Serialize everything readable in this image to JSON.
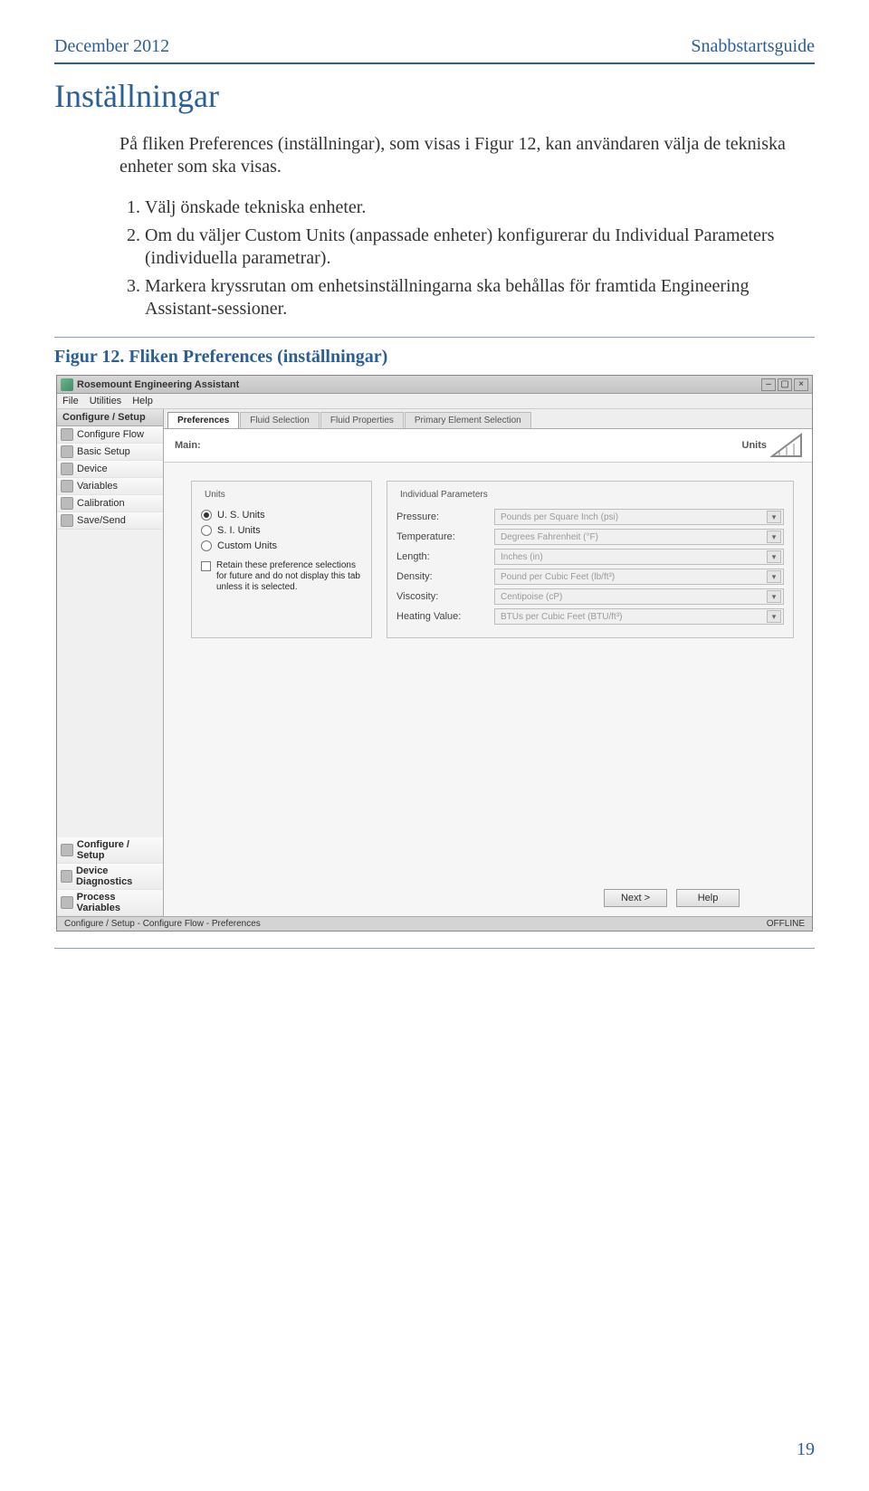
{
  "doc": {
    "date": "December 2012",
    "guide_label": "Snabbstartsguide",
    "section_title": "Inställningar",
    "intro": "På fliken Preferences (inställningar), som visas i Figur 12, kan användaren välja de tekniska enheter som ska visas.",
    "steps": [
      "Välj önskade tekniska enheter.",
      "Om du väljer Custom Units (anpassade enheter) konfigurerar du Individual Parameters (individuella parametrar).",
      "Markera kryssrutan om enhetsinställningarna ska behållas för framtida Engineering Assistant-sessioner."
    ],
    "figure_caption": "Figur 12. Fliken Preferences (inställningar)",
    "page_number": "19"
  },
  "app": {
    "title": "Rosemount Engineering Assistant",
    "menus": [
      "File",
      "Utilities",
      "Help"
    ],
    "nav_header": "Configure / Setup",
    "nav_items": [
      "Configure Flow",
      "Basic Setup",
      "Device",
      "Variables",
      "Calibration",
      "Save/Send"
    ],
    "nav_bottom": [
      "Configure / Setup",
      "Device Diagnostics",
      "Process Variables"
    ],
    "tabs": [
      "Preferences",
      "Fluid Selection",
      "Fluid Properties",
      "Primary Element Selection"
    ],
    "subheader_left": "Main:",
    "subheader_right": "Units",
    "units_legend": "Units",
    "unit_options": [
      {
        "label": "U. S. Units",
        "checked": true
      },
      {
        "label": "S. I. Units",
        "checked": false
      },
      {
        "label": "Custom Units",
        "checked": false
      }
    ],
    "retain_text": "Retain these preference selections for future and do not display this tab unless it is selected.",
    "params_legend": "Individual Parameters",
    "params": [
      {
        "label": "Pressure:",
        "value": "Pounds per Square Inch (psi)"
      },
      {
        "label": "Temperature:",
        "value": "Degrees Fahrenheit (°F)"
      },
      {
        "label": "Length:",
        "value": "Inches (in)"
      },
      {
        "label": "Density:",
        "value": "Pound per Cubic Feet (lb/ft³)"
      },
      {
        "label": "Viscosity:",
        "value": "Centipoise (cP)"
      },
      {
        "label": "Heating Value:",
        "value": "BTUs per Cubic Feet (BTU/ft³)"
      }
    ],
    "buttons": {
      "next": "Next >",
      "help": "Help"
    },
    "status_left": "Configure / Setup - Configure Flow - Preferences",
    "status_right": "OFFLINE"
  }
}
